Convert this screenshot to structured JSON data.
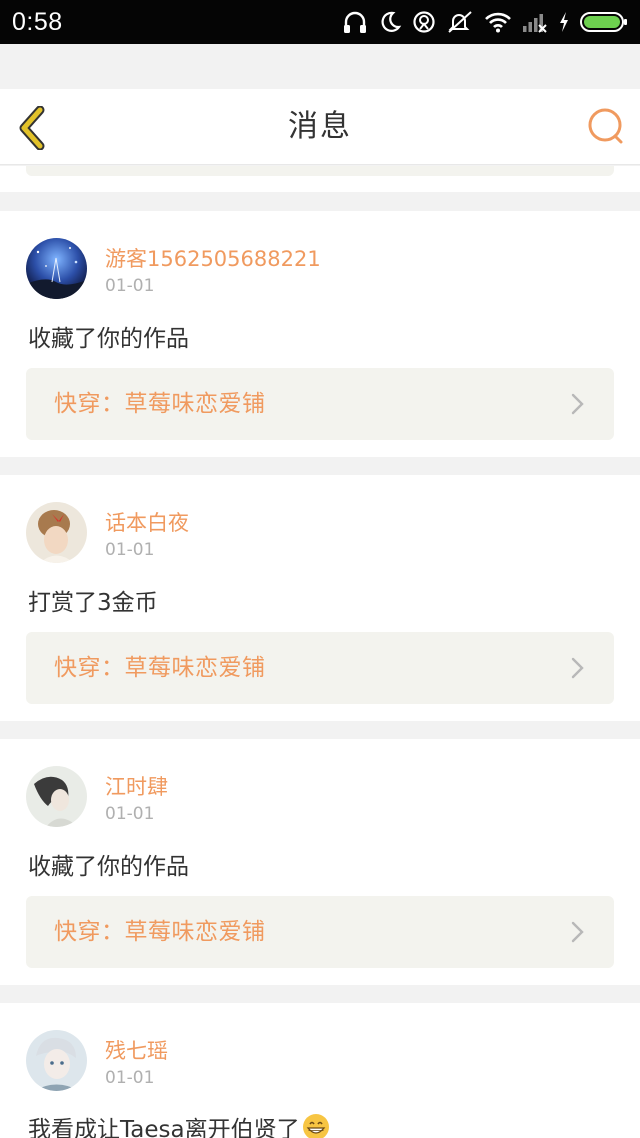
{
  "status_bar": {
    "time": "0:58",
    "icons": [
      "headphones-icon",
      "moon-icon",
      "sync-icon",
      "mute-icon",
      "wifi-icon",
      "signal-icon",
      "charging-icon",
      "battery-icon"
    ]
  },
  "header": {
    "title": "消息",
    "back_icon": "chevron-left-icon",
    "search_icon": "search-icon"
  },
  "colors": {
    "accent": "#f09a5f",
    "back_arrow": "#e2c22a",
    "card_bg": "#ffffff",
    "link_bg": "#f3f3ee",
    "page_bg": "#f2f2f2"
  },
  "messages": [
    {
      "username": "游客1562505688221",
      "date": "01-01",
      "action": "收藏了你的作品",
      "work": "快穿：草莓味恋爱铺"
    },
    {
      "username": "话本白夜",
      "date": "01-01",
      "action": "打赏了3金币",
      "work": "快穿：草莓味恋爱铺"
    },
    {
      "username": "江时肆",
      "date": "01-01",
      "action": "收藏了你的作品",
      "work": "快穿：草莓味恋爱铺"
    },
    {
      "username": "残七瑶",
      "date": "01-01",
      "action": "我看成让Taesa离开伯贤了",
      "emoji": "grinning-emoji"
    }
  ]
}
